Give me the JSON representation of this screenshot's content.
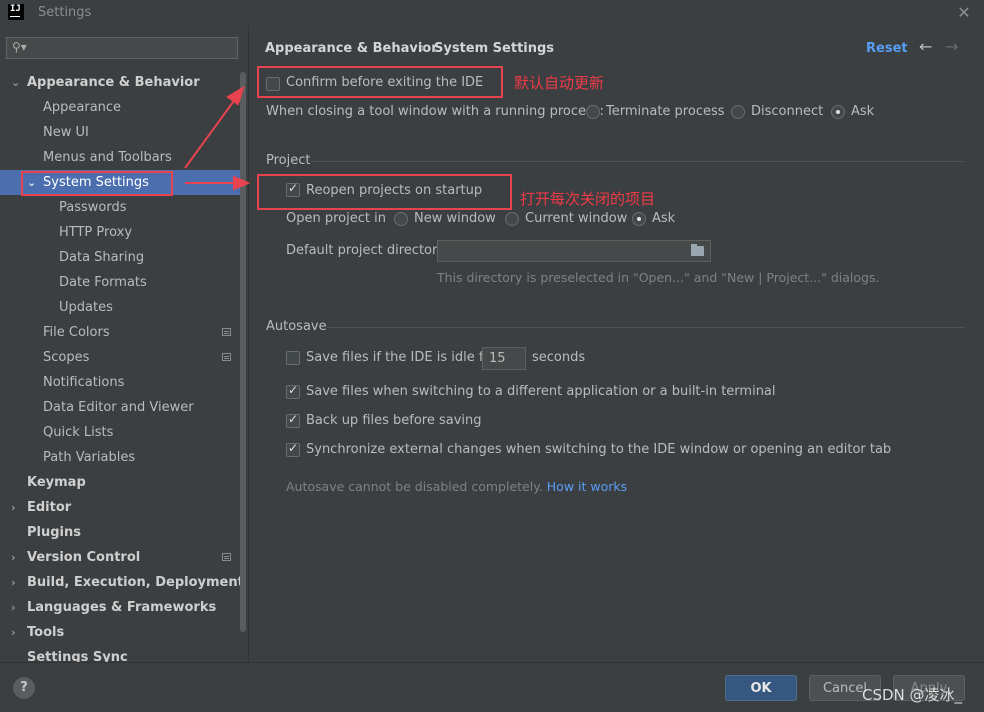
{
  "window": {
    "title": "Settings",
    "app_icon": "IJ"
  },
  "search": {
    "placeholder": ""
  },
  "sidebar": {
    "items": [
      {
        "label": "Appearance & Behavior"
      },
      {
        "label": "Appearance"
      },
      {
        "label": "New UI"
      },
      {
        "label": "Menus and Toolbars"
      },
      {
        "label": "System Settings"
      },
      {
        "label": "Passwords"
      },
      {
        "label": "HTTP Proxy"
      },
      {
        "label": "Data Sharing"
      },
      {
        "label": "Date Formats"
      },
      {
        "label": "Updates"
      },
      {
        "label": "File Colors"
      },
      {
        "label": "Scopes"
      },
      {
        "label": "Notifications"
      },
      {
        "label": "Data Editor and Viewer"
      },
      {
        "label": "Quick Lists"
      },
      {
        "label": "Path Variables"
      },
      {
        "label": "Keymap"
      },
      {
        "label": "Editor"
      },
      {
        "label": "Plugins"
      },
      {
        "label": "Version Control"
      },
      {
        "label": "Build, Execution, Deployment"
      },
      {
        "label": "Languages & Frameworks"
      },
      {
        "label": "Tools"
      },
      {
        "label": "Settings Sync"
      }
    ]
  },
  "header": {
    "breadcrumb_parent": "Appearance & Behavior",
    "breadcrumb_sep": "›",
    "breadcrumb_current": "System Settings",
    "reset": "Reset"
  },
  "general": {
    "confirm_exit": {
      "label": "Confirm before exiting the IDE",
      "checked": false
    },
    "closing_label": "When closing a tool window with a running process:",
    "closing_options": [
      "Terminate process",
      "Disconnect",
      "Ask"
    ],
    "closing_selected": "Ask"
  },
  "project": {
    "section_title": "Project",
    "reopen": {
      "label": "Reopen projects on startup",
      "checked": true
    },
    "open_in_label": "Open project in",
    "open_in_options": [
      "New window",
      "Current window",
      "Ask"
    ],
    "open_in_selected": "Ask",
    "default_dir_label": "Default project directory:",
    "default_dir_value": "",
    "default_dir_hint": "This directory is preselected in \"Open...\" and \"New | Project...\" dialogs."
  },
  "autosave": {
    "section_title": "Autosave",
    "idle_label": "Save files if the IDE is idle for",
    "idle_value": "15",
    "idle_unit": "seconds",
    "idle_checked": false,
    "switch_app": {
      "label": "Save files when switching to a different application or a built-in terminal",
      "checked": true
    },
    "backup": {
      "label": "Back up files before saving",
      "checked": true
    },
    "sync_external": {
      "label": "Synchronize external changes when switching to the IDE window or opening an editor tab",
      "checked": true
    },
    "note": "Autosave cannot be disabled completely.",
    "note_link": "How it works"
  },
  "annotations": {
    "confirm_note": "默认自动更新",
    "reopen_note": "打开每次关闭的项目",
    "color": "#e8434f"
  },
  "footer": {
    "help": "?",
    "ok": "OK",
    "cancel": "Cancel",
    "apply": "Apply",
    "watermark": "CSDN @凌冰_"
  },
  "colors": {
    "background": "#3c3f41",
    "selection": "#4b6eaf",
    "link": "#589df6",
    "ok_button": "#365880"
  }
}
